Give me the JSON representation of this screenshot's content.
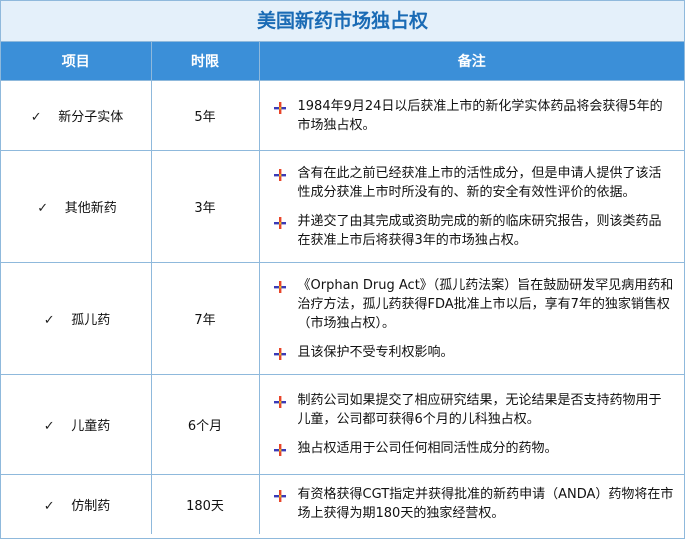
{
  "title": "美国新药市场独占权",
  "headers": {
    "item": "项目",
    "time": "时限",
    "notes": "备注"
  },
  "colors": {
    "header_bg": "#3b8fd8",
    "title_text": "#1a6bb5",
    "border": "#8fb9dc"
  },
  "rows": [
    {
      "item": "新分子实体",
      "time": "5年",
      "notes": [
        "1984年9月24日以后获准上市的新化学实体药品将会获得5年的市场独占权。"
      ]
    },
    {
      "item": "其他新药",
      "time": "3年",
      "notes": [
        "含有在此之前已经获准上市的活性成分，但是申请人提供了该活性成分获准上市时所没有的、新的安全有效性评价的依据。",
        "并递交了由其完成或资助完成的新的临床研究报告，则该类药品在获准上市后将获得3年的市场独占权。"
      ]
    },
    {
      "item": "孤儿药",
      "time": "7年",
      "notes": [
        "《Orphan Drug Act》（孤儿药法案）旨在鼓励研发罕见病用药和治疗方法，孤儿药获得FDA批准上市以后，享有7年的独家销售权（市场独占权）。",
        "且该保护不受专利权影响。"
      ]
    },
    {
      "item": "儿童药",
      "time": "6个月",
      "notes": [
        "制药公司如果提交了相应研究结果，无论结果是否支持药物用于儿童，公司都可获得6个月的儿科独占权。",
        "独占权适用于公司任何相同活性成分的药物。"
      ]
    },
    {
      "item": "仿制药",
      "time": "180天",
      "notes": [
        "有资格获得CGT指定并获得批准的新药申请（ANDA）药物将在市场上获得为期180天的独家经营权。"
      ]
    }
  ]
}
